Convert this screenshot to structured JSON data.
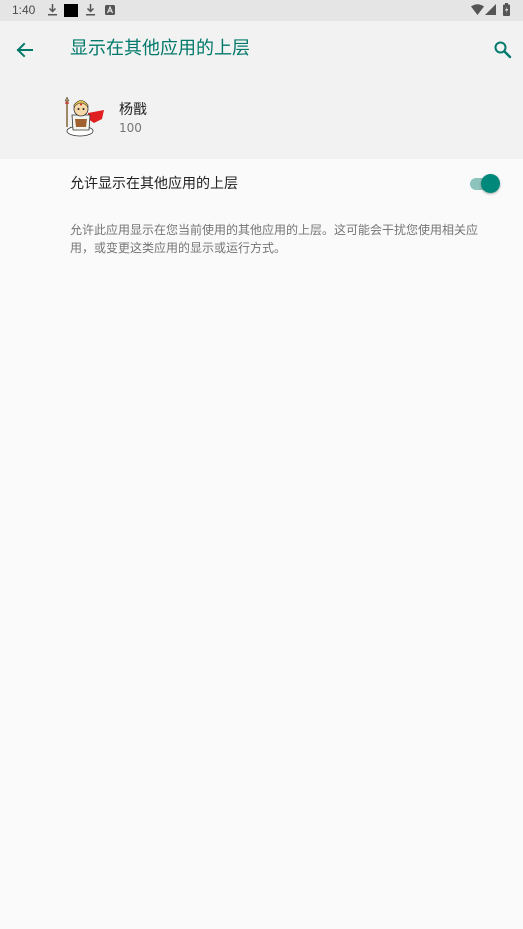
{
  "status_bar": {
    "time": "1:40",
    "icons": [
      "download-icon",
      "black-square-icon",
      "download-icon",
      "a-box-icon",
      "wifi-icon",
      "signal-icon",
      "battery-icon"
    ]
  },
  "app_bar": {
    "title": "显示在其他应用的上层",
    "icons": [
      "back-arrow-icon",
      "search-icon"
    ]
  },
  "app_header": {
    "name": "杨戬",
    "version": "100"
  },
  "setting": {
    "label": "允许显示在其他应用的上层",
    "enabled": true
  },
  "description": "允许此应用显示在您当前使用的其他应用的上层。这可能会干扰您使用相关应用，或变更这类应用的显示或运行方式。",
  "colors": {
    "accent": "#00796b",
    "toggle_thumb": "#00897b",
    "toggle_track": "#8cc3bd"
  }
}
